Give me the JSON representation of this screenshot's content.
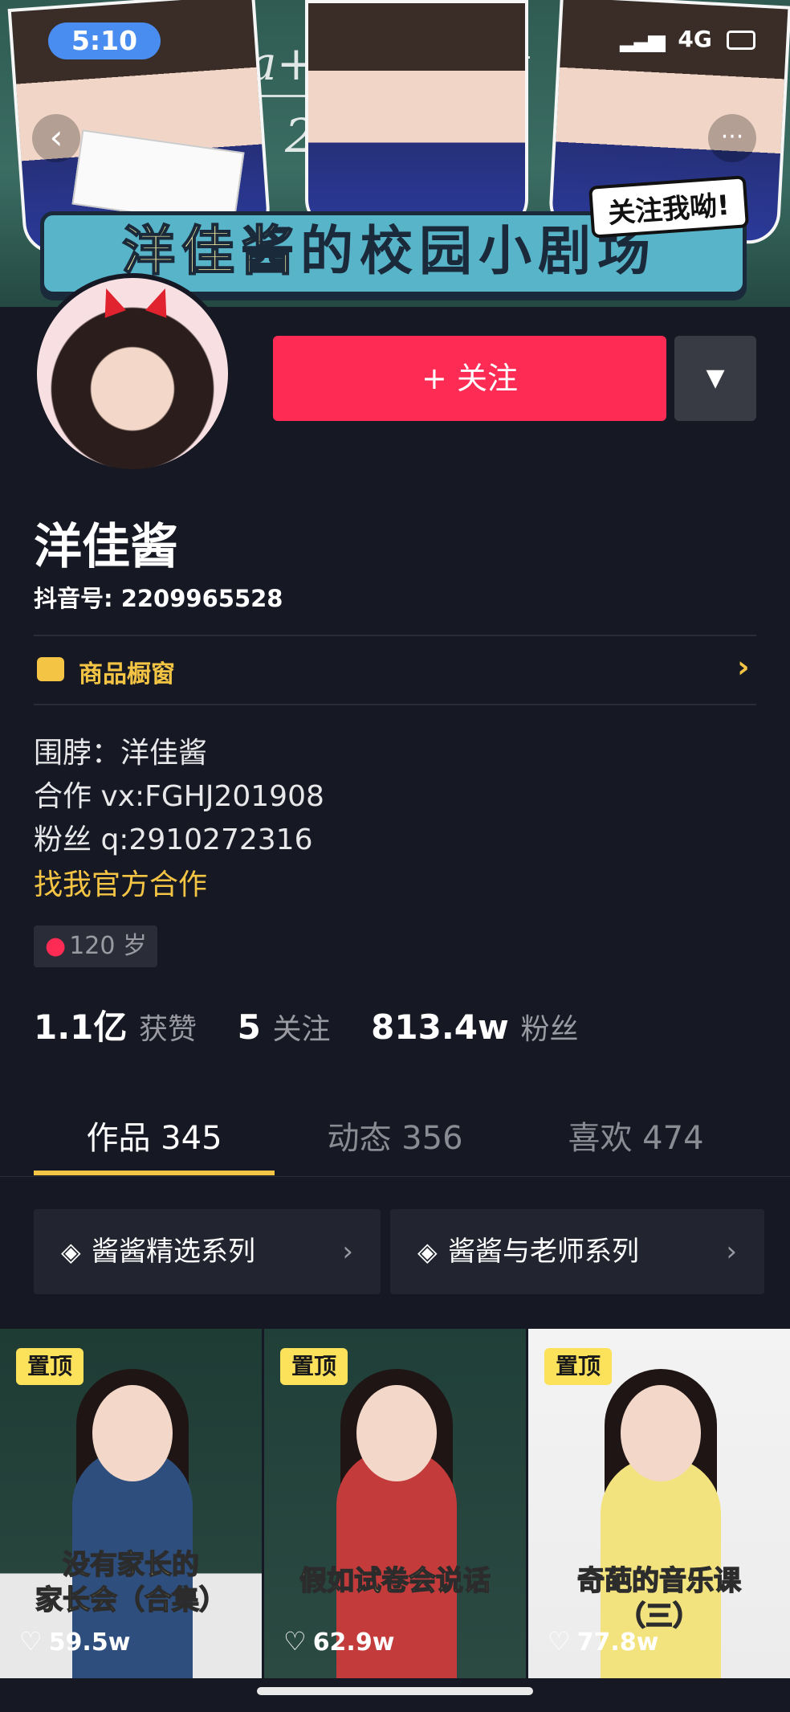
{
  "status_bar": {
    "time": "5:10",
    "network": "4G"
  },
  "banner": {
    "title_highlight": "洋佳酱",
    "title_rest": "的校园小剧场",
    "sticker": "关注我呦!",
    "board_left_top": "a+",
    "board_left_bottom": "2",
    "board_right": "ab"
  },
  "nav": {
    "back": "‹",
    "more": "···"
  },
  "profile": {
    "follow_label": "+ 关注",
    "dropdown_icon": "▼",
    "name": "洋佳酱",
    "uid": "抖音号: 2209965528",
    "shop_label": "商品橱窗",
    "bio": [
      "围脖：洋佳酱",
      "合作 vx:FGHJ201908",
      "粉丝 q:2910272316"
    ],
    "bio_link": "找我官方合作",
    "age_tag": "120 岁",
    "stats": {
      "likes_value": "1.1亿",
      "likes_label": "获赞",
      "following_value": "5",
      "following_label": "关注",
      "followers_value": "813.4w",
      "followers_label": "粉丝"
    }
  },
  "tabs": [
    {
      "label": "作品 345",
      "active": true
    },
    {
      "label": "动态 356",
      "active": false
    },
    {
      "label": "喜欢 474",
      "active": false
    }
  ],
  "series": [
    {
      "label": "酱酱精选系列"
    },
    {
      "label": "酱酱与老师系列"
    }
  ],
  "videos": [
    {
      "pin": "置顶",
      "caption_1": "没有家长的",
      "caption_2": "家长会（合集）",
      "likes": "59.5w"
    },
    {
      "pin": "置顶",
      "caption_1": "假如试卷会说话",
      "caption_2": "",
      "likes": "62.9w"
    },
    {
      "pin": "置顶",
      "caption_1": "奇葩的音乐课",
      "caption_2": "（三）",
      "likes": "77.8w"
    }
  ],
  "colors": {
    "background": "#161823",
    "accent_red": "#fe2c55",
    "accent_yellow": "#f4c445"
  }
}
